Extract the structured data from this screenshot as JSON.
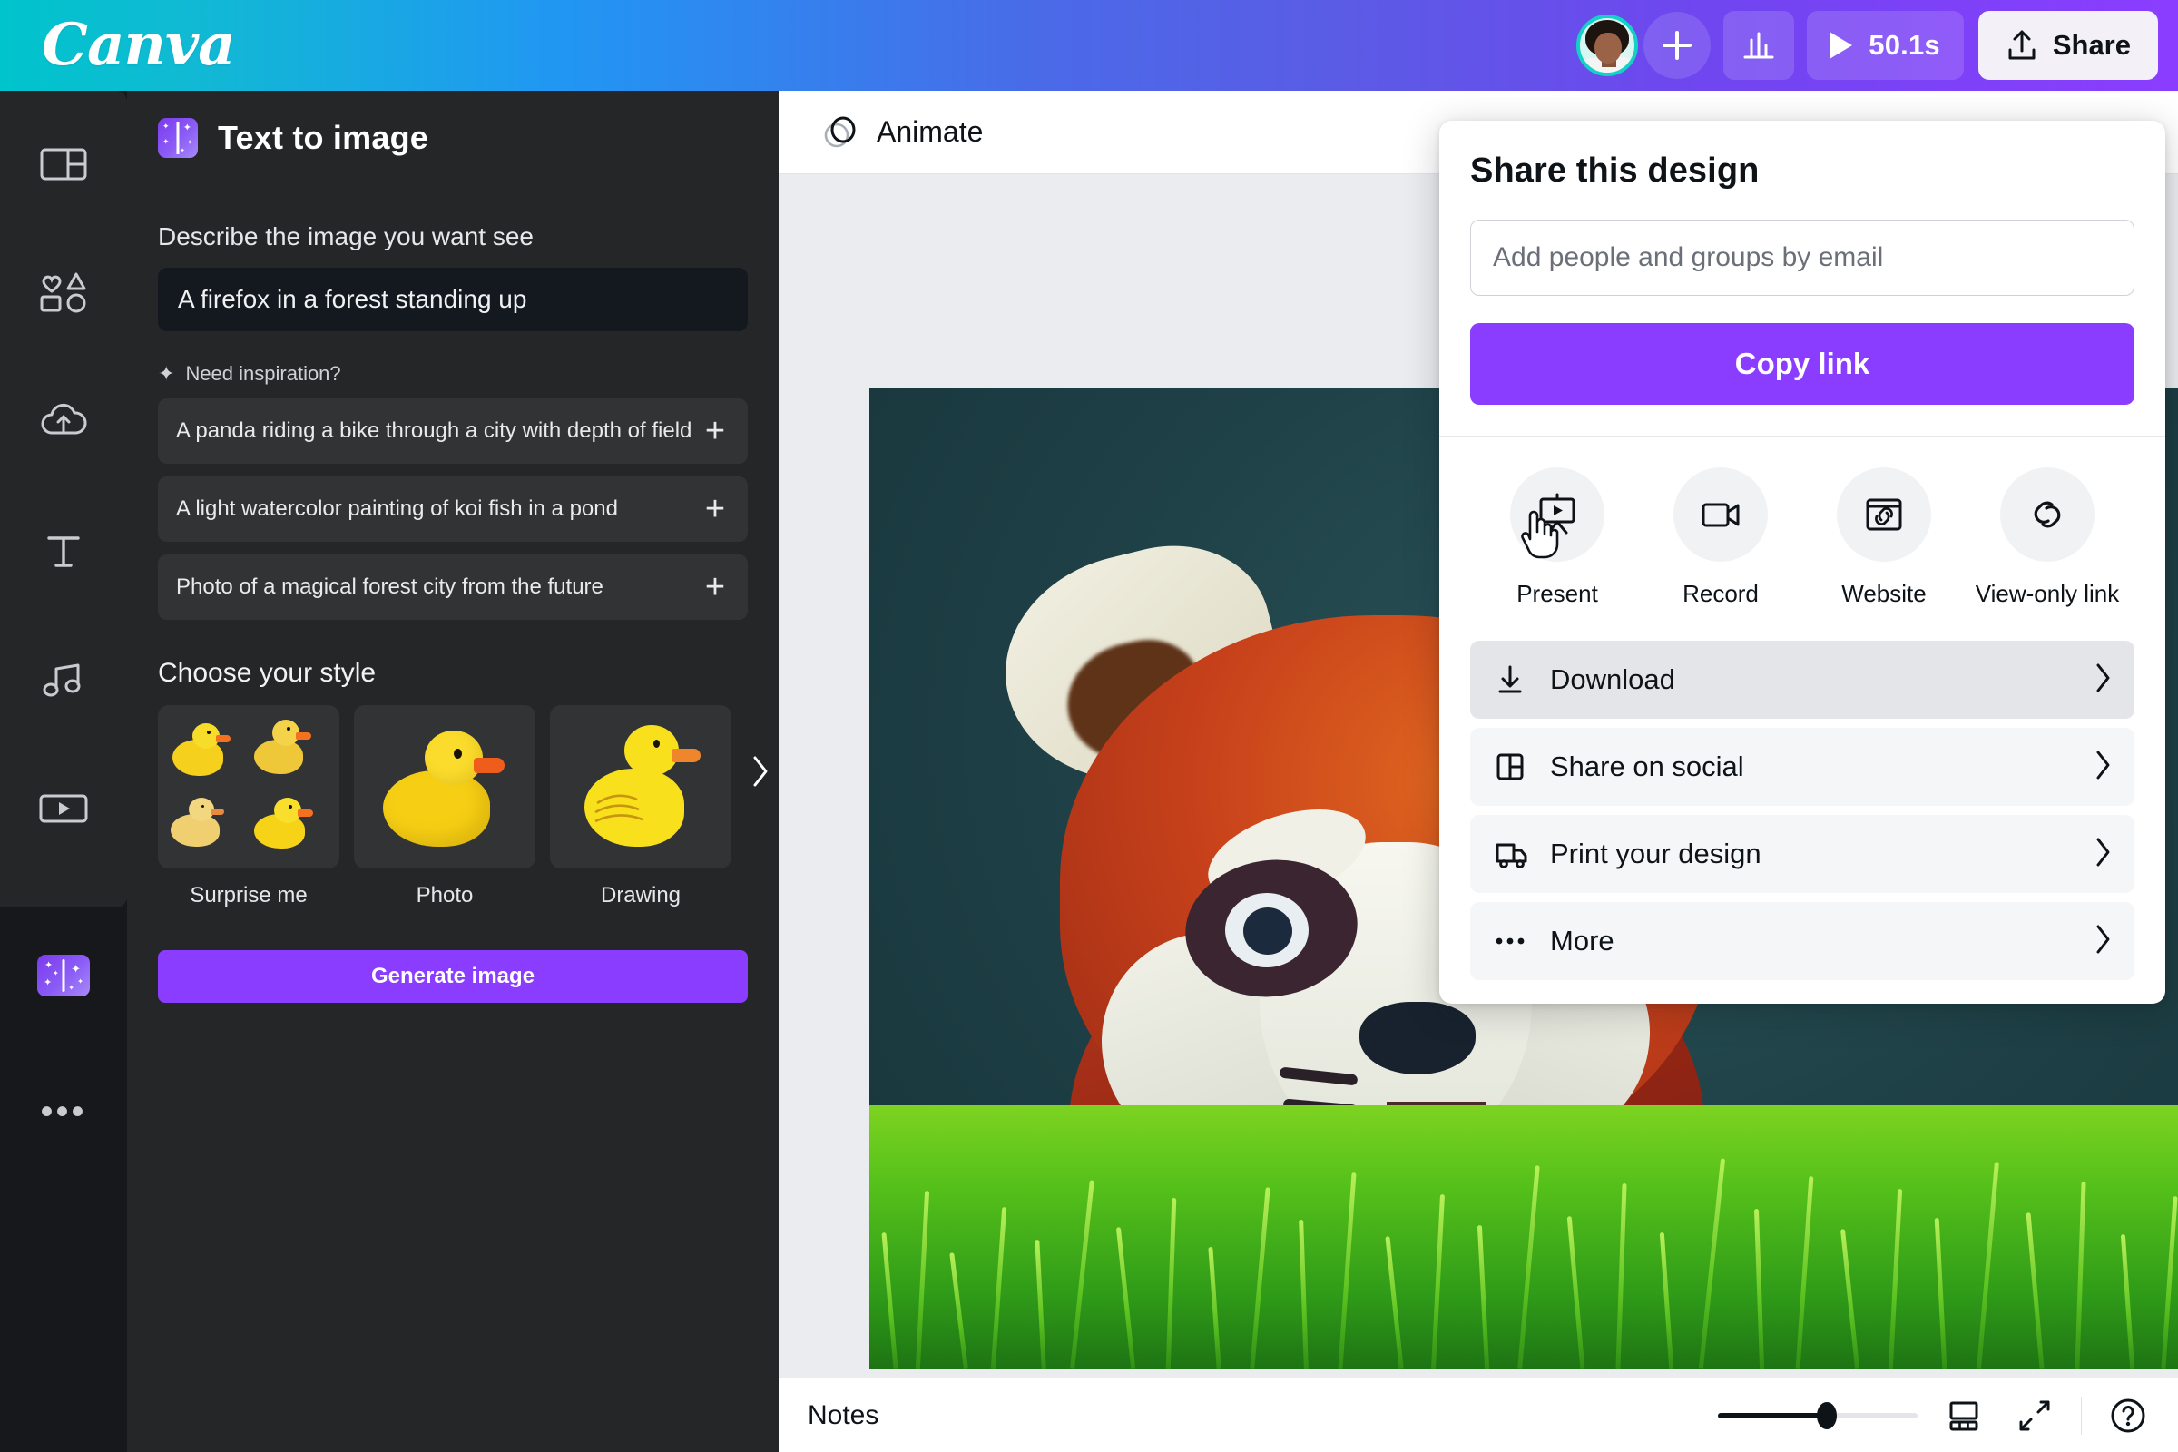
{
  "topbar": {
    "logo": "Canva",
    "avatar_name": "user-avatar",
    "add_label": "+",
    "analytics_icon": "bar-chart-icon",
    "play_icon": "play-icon",
    "duration": "50.1s",
    "share_label": "Share",
    "share_icon": "upload-share-icon"
  },
  "rail": {
    "items": [
      {
        "name": "design",
        "icon": "layout-icon"
      },
      {
        "name": "elements",
        "icon": "shapes-icon"
      },
      {
        "name": "uploads",
        "icon": "cloud-upload-icon"
      },
      {
        "name": "text",
        "icon": "text-t-icon"
      },
      {
        "name": "audio",
        "icon": "music-note-icon"
      },
      {
        "name": "videos",
        "icon": "video-play-icon"
      }
    ],
    "app_item": {
      "name": "text-to-image-app",
      "icon": "magic-wand-icon"
    },
    "more_label": "•••"
  },
  "panel": {
    "title": "Text to image",
    "app_icon": "magic-wand-icon",
    "prompt_label": "Describe the image you want see",
    "prompt_value": "A firefox in a forest standing up",
    "prompt_placeholder": "Describe the image you want see",
    "inspiration_header": "Need inspiration?",
    "inspiration_icon": "sparkle-icon",
    "suggestions": [
      {
        "text": "A panda riding a bike through a city with depth of field",
        "add": "+"
      },
      {
        "text": "A light watercolor painting of koi fish in a pond",
        "add": "+"
      },
      {
        "text": "Photo of a magical forest city from the future",
        "add": "+"
      }
    ],
    "style_header": "Choose your style",
    "styles": [
      {
        "label": "Surprise me",
        "thumb": "four-ducks-grid"
      },
      {
        "label": "Photo",
        "thumb": "photo-duck"
      },
      {
        "label": "Drawing",
        "thumb": "drawing-duck"
      }
    ],
    "carousel_next_icon": "chevron-right-icon",
    "generate_label": "Generate image"
  },
  "editor": {
    "toolbar": {
      "animate_label": "Animate",
      "animate_icon": "animate-circles-icon"
    },
    "canvas": {
      "artwork_alt": "red panda standing in grass",
      "background_color": "#1e4147",
      "grass_color": "#56c11a",
      "fur_color": "#c03a1c"
    }
  },
  "share_popover": {
    "title": "Share this design",
    "email_placeholder": "Add people and groups by email",
    "email_value": "",
    "copy_link_label": "Copy link",
    "accent_color": "#8b3dff",
    "quick_actions": [
      {
        "label": "Present",
        "icon": "present-screen-icon"
      },
      {
        "label": "Record",
        "icon": "video-camera-icon"
      },
      {
        "label": "Website",
        "icon": "website-window-icon"
      },
      {
        "label": "View-only link",
        "icon": "link-chain-icon"
      }
    ],
    "menu_items": [
      {
        "label": "Download",
        "icon": "download-icon",
        "chevron": "chevron-right-icon",
        "hovered": true
      },
      {
        "label": "Share on social",
        "icon": "social-grid-icon",
        "chevron": "chevron-right-icon",
        "hovered": false
      },
      {
        "label": "Print your design",
        "icon": "truck-icon",
        "chevron": "chevron-right-icon",
        "hovered": false
      },
      {
        "label": "More",
        "icon": "ellipsis-icon",
        "chevron": "chevron-right-icon",
        "hovered": false
      }
    ]
  },
  "bottombar": {
    "notes_label": "Notes",
    "zoom_percent": 55,
    "pages_icon": "grid-pages-icon",
    "fullscreen_icon": "expand-arrows-icon",
    "help_icon": "help-question-icon"
  }
}
